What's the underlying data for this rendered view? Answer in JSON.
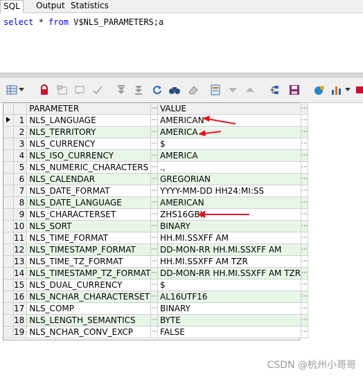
{
  "tabs": [
    "SQL",
    "Output",
    "Statistics"
  ],
  "sql": {
    "kw1": "select",
    "star": " * ",
    "kw2": "from",
    "rest": " V$NLS_PARAMETERS;a"
  },
  "grid": {
    "columns": [
      "PARAMETER",
      "VALUE"
    ],
    "rows": [
      {
        "n": "1",
        "param": "NLS_LANGUAGE",
        "value": "AMERICAN"
      },
      {
        "n": "2",
        "param": "NLS_TERRITORY",
        "value": "AMERICA"
      },
      {
        "n": "3",
        "param": "NLS_CURRENCY",
        "value": "$"
      },
      {
        "n": "4",
        "param": "NLS_ISO_CURRENCY",
        "value": "AMERICA"
      },
      {
        "n": "5",
        "param": "NLS_NUMERIC_CHARACTERS",
        "value": ".,"
      },
      {
        "n": "6",
        "param": "NLS_CALENDAR",
        "value": "GREGORIAN"
      },
      {
        "n": "7",
        "param": "NLS_DATE_FORMAT",
        "value": "YYYY-MM-DD HH24:MI:SS"
      },
      {
        "n": "8",
        "param": "NLS_DATE_LANGUAGE",
        "value": "AMERICAN"
      },
      {
        "n": "9",
        "param": "NLS_CHARACTERSET",
        "value": "ZHS16GBK"
      },
      {
        "n": "10",
        "param": "NLS_SORT",
        "value": "BINARY"
      },
      {
        "n": "11",
        "param": "NLS_TIME_FORMAT",
        "value": "HH.MI.SSXFF AM"
      },
      {
        "n": "12",
        "param": "NLS_TIMESTAMP_FORMAT",
        "value": "DD-MON-RR HH.MI.SSXFF AM"
      },
      {
        "n": "13",
        "param": "NLS_TIME_TZ_FORMAT",
        "value": "HH.MI.SSXFF AM TZR"
      },
      {
        "n": "14",
        "param": "NLS_TIMESTAMP_TZ_FORMAT",
        "value": "DD-MON-RR HH.MI.SSXFF AM TZR"
      },
      {
        "n": "15",
        "param": "NLS_DUAL_CURRENCY",
        "value": "$"
      },
      {
        "n": "16",
        "param": "NLS_NCHAR_CHARACTERSET",
        "value": "AL16UTF16"
      },
      {
        "n": "17",
        "param": "NLS_COMP",
        "value": "BINARY"
      },
      {
        "n": "18",
        "param": "NLS_LENGTH_SEMANTICS",
        "value": "BYTE"
      },
      {
        "n": "19",
        "param": "NLS_NCHAR_CONV_EXCP",
        "value": "FALSE"
      }
    ]
  },
  "ellipsis": "···",
  "watermark": "CSDN @杭州小哥哥",
  "colors": {
    "even_row": "#e8f6e8",
    "arrow": "#e8141e",
    "keyword": "#0000ff"
  }
}
